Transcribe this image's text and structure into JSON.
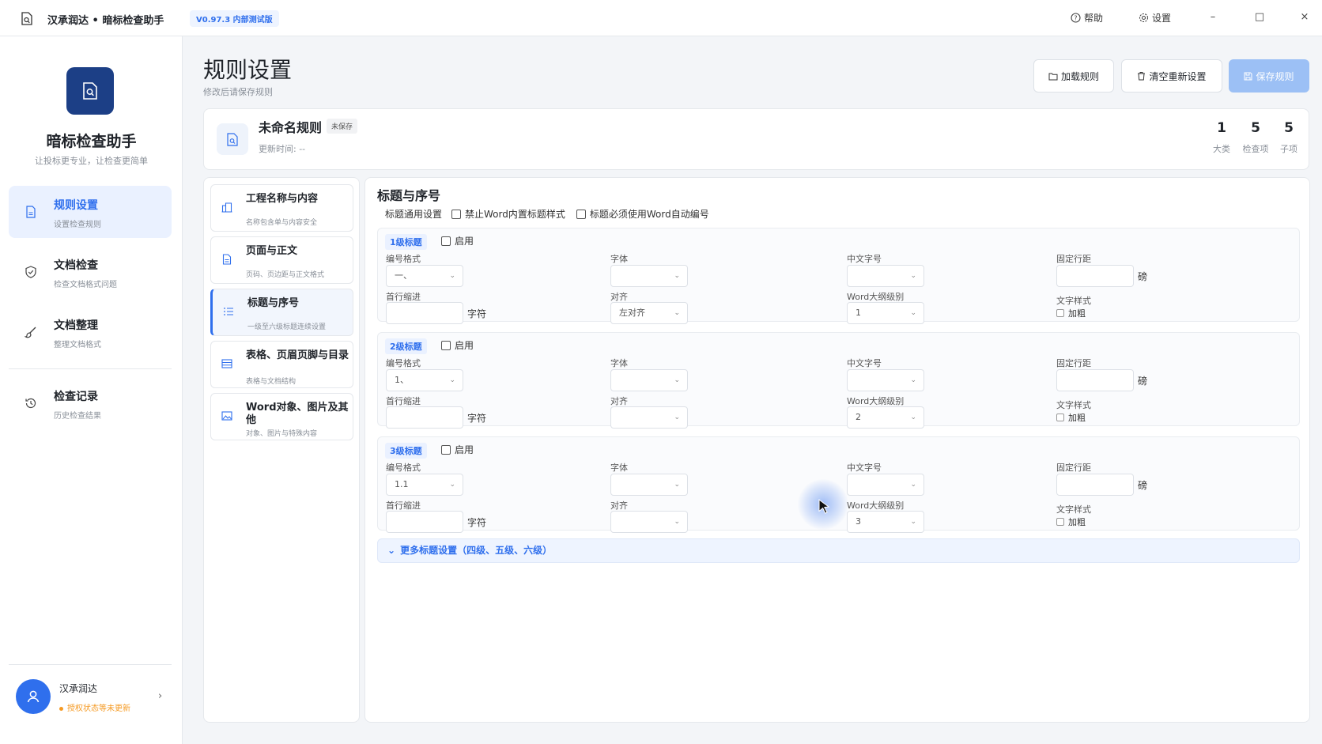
{
  "titlebar": {
    "app_title": "汉承润达 • 暗标检查助手",
    "version": "V0.97.3 内部测试版",
    "help_label": "帮助",
    "settings_label": "设置",
    "minimize": "–",
    "maximize": "□",
    "close": "×"
  },
  "sidebar": {
    "brand_title": "暗标检查助手",
    "brand_sub": "让投标更专业，让检查更简单",
    "items": [
      {
        "label": "规则设置",
        "sub": "设置检查规则",
        "icon": "document-icon",
        "active": true
      },
      {
        "label": "文档检查",
        "sub": "检查文档格式问题",
        "icon": "shield-check-icon",
        "active": false
      },
      {
        "label": "文档整理",
        "sub": "整理文档格式",
        "icon": "brush-icon",
        "active": false
      },
      {
        "label": "检查记录",
        "sub": "历史检查结果",
        "icon": "history-icon",
        "active": false
      }
    ],
    "user": {
      "name": "汉承润达",
      "status": "授权状态等未更新"
    }
  },
  "header": {
    "title": "规则设置",
    "subtitle": "修改后请保存规则",
    "load_label": "加载规则",
    "reset_label": "清空重新设置",
    "save_label": "保存规则"
  },
  "rule": {
    "name": "未命名规则",
    "badge": "未保存",
    "updated": "更新时间: --",
    "stats": [
      {
        "num": "1",
        "label": "大类"
      },
      {
        "num": "5",
        "label": "检查项"
      },
      {
        "num": "5",
        "label": "子项"
      }
    ]
  },
  "categories": [
    {
      "label": "工程名称与内容",
      "sub": "名称包含单与内容安全",
      "icon": "building-icon",
      "active": false
    },
    {
      "label": "页面与正文",
      "sub": "页码、页边距与正文格式",
      "icon": "page-icon",
      "active": false
    },
    {
      "label": "标题与序号",
      "sub": "一级至六级标题连续设置",
      "icon": "list-icon",
      "active": true
    },
    {
      "label": "表格、页眉页脚与目录",
      "sub": "表格与文档结构",
      "icon": "table-icon",
      "active": false
    },
    {
      "label": "Word对象、图片及其他",
      "sub": "对象、图片与特殊内容",
      "icon": "image-icon",
      "active": false
    }
  ],
  "main": {
    "section_title": "标题与序号",
    "general_label": "标题通用设置",
    "opt_disable_builtin": "禁止Word内置标题样式",
    "opt_must_autonumber": "标题必须使用Word自动编号",
    "labels": {
      "enable": "启用",
      "number_format": "编号格式",
      "font": "字体",
      "cn_size": "中文字号",
      "line_spacing": "固定行距",
      "indent": "首行缩进",
      "align": "对齐",
      "outline_level": "Word大纲级别",
      "text_style": "文字样式",
      "unit_char": "字符",
      "unit_pt": "磅",
      "bold": "加粗"
    },
    "levels": [
      {
        "tag": "1级标题",
        "number_format": "一、",
        "align": "左对齐",
        "outline_level": "1"
      },
      {
        "tag": "2级标题",
        "number_format": "1、",
        "align": "",
        "outline_level": "2"
      },
      {
        "tag": "3级标题",
        "number_format": "1.1",
        "align": "",
        "outline_level": "3"
      }
    ],
    "more_label": "更多标题设置（四级、五级、六级）"
  },
  "colors": {
    "accent": "#2f6fed",
    "brand_dark": "#1c3f86",
    "warning": "#f59a23"
  }
}
